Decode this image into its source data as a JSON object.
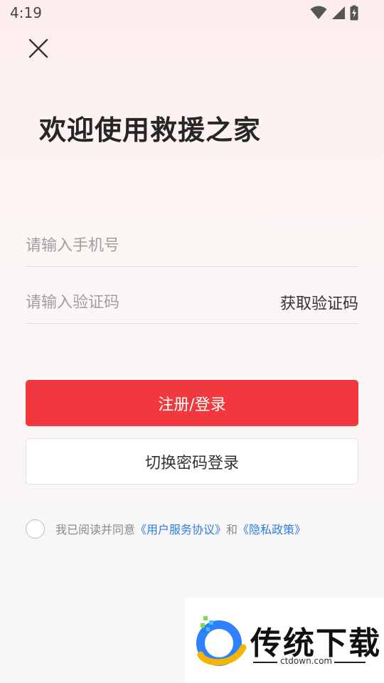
{
  "status_bar": {
    "time": "4:19",
    "icons": [
      "wifi-icon",
      "signal-icon",
      "battery-charging-icon"
    ]
  },
  "header": {
    "close_icon": "close-icon",
    "title": "欢迎使用救援之家"
  },
  "form": {
    "phone_placeholder": "请输入手机号",
    "phone_value": "",
    "code_placeholder": "请输入验证码",
    "code_value": "",
    "get_code_label": "获取验证码"
  },
  "actions": {
    "register_login_label": "注册/登录",
    "switch_password_label": "切换密码登录"
  },
  "agreement": {
    "checked": false,
    "prefix": "我已阅读并同意",
    "user_agreement": "《用户服务协议》",
    "conjunction": "和",
    "privacy_policy": "《隐私政策》"
  },
  "watermark": {
    "brand": "传统下载",
    "url": "ctdown.com"
  },
  "colors": {
    "primary": "#f2383f",
    "link": "#2f7fe0",
    "placeholder": "#a0a0a0"
  }
}
